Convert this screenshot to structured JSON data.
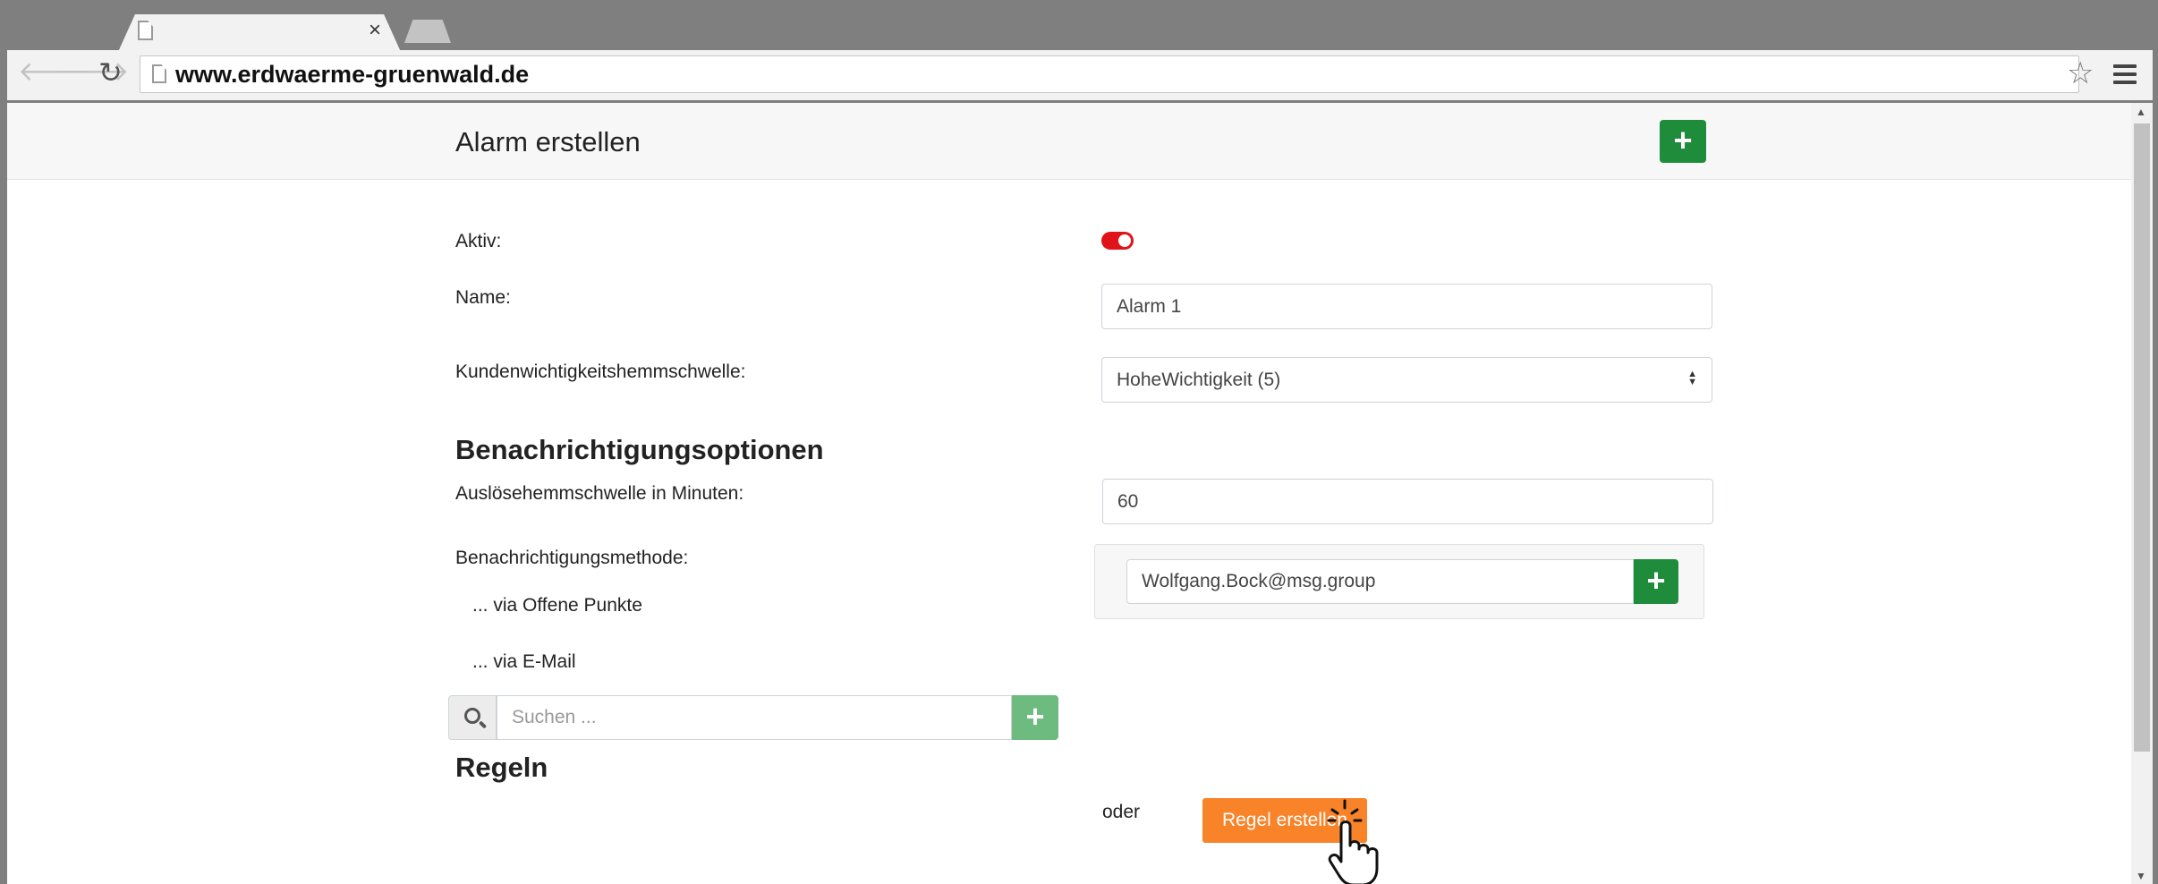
{
  "browser": {
    "url": "www.erdwaerme-gruenwald.de",
    "icons": {
      "back": "arrow-left-icon",
      "forward": "arrow-right-icon",
      "reload": "reload-icon",
      "bookmark": "star-icon",
      "menu": "hamburger-menu-icon",
      "close_tab": "close-icon"
    }
  },
  "header": {
    "title": "Alarm erstellen",
    "add_label": "+"
  },
  "form": {
    "active": {
      "label": "Aktiv:",
      "value": true
    },
    "name": {
      "label": "Name:",
      "value": "Alarm 1"
    },
    "threshold": {
      "label": "Kundenwichtigkeitshemmschwelle:",
      "value": "HoheWichtigkeit (5)"
    }
  },
  "notifications": {
    "title": "Benachrichtigungsoptionen",
    "trigger": {
      "label": "Auslösehemmschwelle in Minuten:",
      "value": "60"
    },
    "method_label": "Benachrichtigungsmethode:",
    "open_points": {
      "label": "... via Offene Punkte",
      "value": false
    },
    "email": {
      "label": "... via E-Mail",
      "value": "Wolfgang.Bock@msg.group",
      "add_label": "+"
    }
  },
  "rules": {
    "title": "Regeln",
    "search_placeholder": "Suchen ...",
    "add_label": "+",
    "or_label": "oder",
    "create_label": "Regel erstellen"
  },
  "colors": {
    "primary_green": "#1e8c3a",
    "light_green": "#6dbb7f",
    "toggle_on": "#e0131b",
    "orange": "#f98329"
  }
}
